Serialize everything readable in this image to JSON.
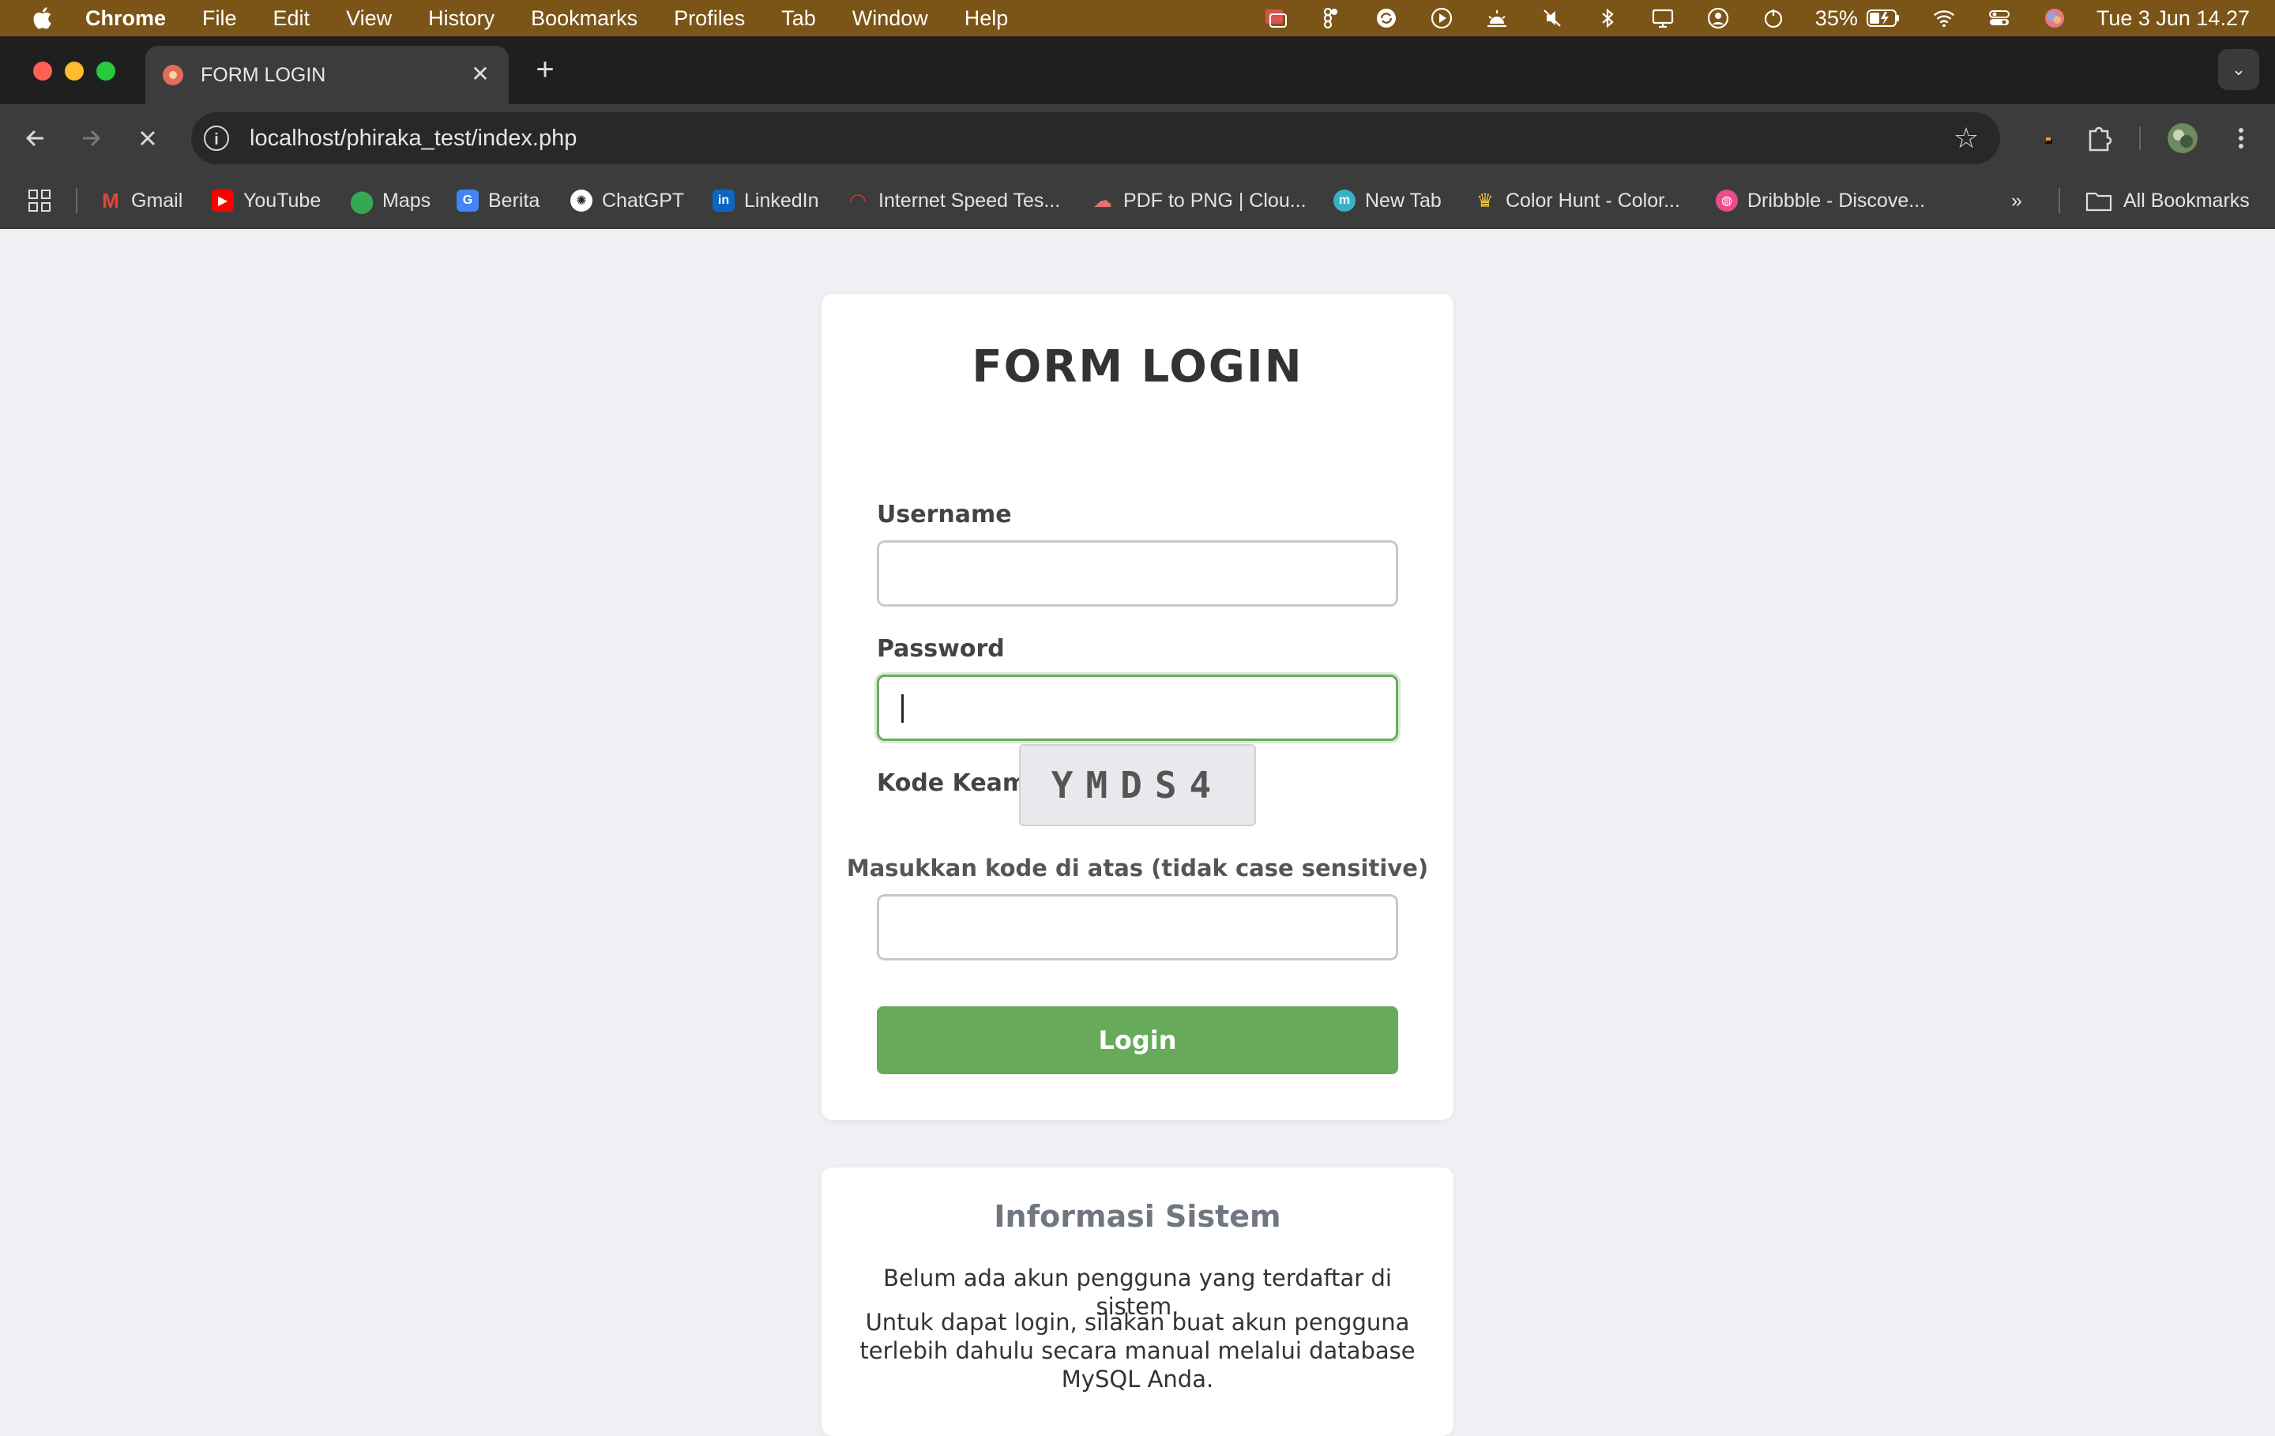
{
  "menubar": {
    "app_name": "Chrome",
    "items": [
      "File",
      "Edit",
      "View",
      "History",
      "Bookmarks",
      "Profiles",
      "Tab",
      "Window",
      "Help"
    ],
    "battery": "35%",
    "datetime": "Tue 3 Jun  14.27"
  },
  "tab": {
    "title": "FORM LOGIN"
  },
  "toolbar": {
    "url": "localhost/phiraka_test/index.php"
  },
  "bookmarks": {
    "items": [
      {
        "label": "Gmail",
        "icon": "gmail-icon",
        "color": "#ea4335"
      },
      {
        "label": "YouTube",
        "icon": "youtube-icon",
        "color": "#ff0000"
      },
      {
        "label": "Maps",
        "icon": "maps-icon",
        "color": "#34a853"
      },
      {
        "label": "Berita",
        "icon": "news-icon",
        "color": "#4285f4"
      },
      {
        "label": "ChatGPT",
        "icon": "chatgpt-icon",
        "color": "#ffffff"
      },
      {
        "label": "LinkedIn",
        "icon": "linkedin-icon",
        "color": "#0a66c2"
      },
      {
        "label": "Internet Speed Tes...",
        "icon": "speedtest-icon",
        "color": "#d93025"
      },
      {
        "label": "PDF to PNG | Clou...",
        "icon": "cloud-icon",
        "color": "#e8716b"
      },
      {
        "label": "New Tab",
        "icon": "newtab-icon",
        "color": "#3ab0c8"
      },
      {
        "label": "Color Hunt - Color...",
        "icon": "colorhunt-icon",
        "color": "#f5c542"
      },
      {
        "label": "Dribbble - Discove...",
        "icon": "dribbble-icon",
        "color": "#ea4c89"
      }
    ],
    "all_bookmarks": "All Bookmarks"
  },
  "login": {
    "title": "FORM LOGIN",
    "username_label": "Username",
    "username_value": "",
    "password_label": "Password",
    "password_value": "",
    "captcha_label": "Kode Keamanan",
    "captcha_code": "YMDS4",
    "captcha_hint": "Masukkan kode di atas (tidak case sensitive)",
    "captcha_value": "",
    "button": "Login",
    "accent_color": "#67aa5a"
  },
  "info": {
    "title": "Informasi Sistem",
    "line1": "Belum ada akun pengguna yang terdaftar di sistem.",
    "line2": "Untuk dapat login, silakan buat akun pengguna terlebih dahulu secara manual melalui database MySQL Anda."
  }
}
